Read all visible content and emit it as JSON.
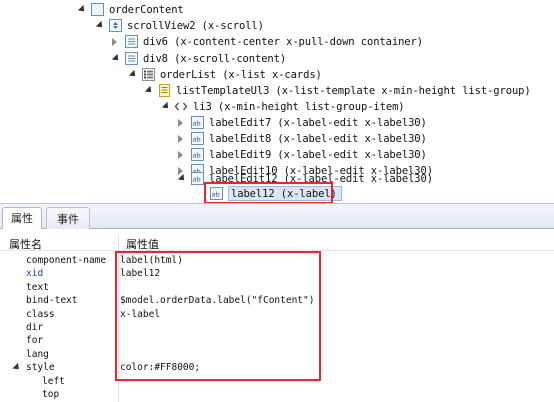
{
  "tree": {
    "nodes": [
      {
        "label": "orderContent"
      },
      {
        "label": "scrollView2 (x-scroll)"
      },
      {
        "label": "div6 (x-content-center x-pull-down container)"
      },
      {
        "label": "div8 (x-scroll-content)"
      },
      {
        "label": "orderList (x-list x-cards)"
      },
      {
        "label": "listTemplateUl3 (x-list-template x-min-height list-group)"
      },
      {
        "label": "li3 (x-min-height list-group-item)"
      },
      {
        "label": "labelEdit7 (x-label-edit x-label30)"
      },
      {
        "label": "labelEdit8 (x-label-edit x-label30)"
      },
      {
        "label": "labelEdit9 (x-label-edit x-label30)"
      },
      {
        "label": "labelEdit10 (x-label-edit x-label30)"
      },
      {
        "label": "labelEdit12 (x-label-edit x-label30)"
      },
      {
        "label": "label12 (x-label)"
      }
    ]
  },
  "tabs": [
    {
      "label": "属性"
    },
    {
      "label": "事件"
    }
  ],
  "properties": {
    "header": {
      "name": "属性名",
      "value": "属性值"
    },
    "rows": [
      {
        "name": "component-name",
        "value": "label(html)"
      },
      {
        "name": "xid",
        "value": "label12"
      },
      {
        "name": "text",
        "value": ""
      },
      {
        "name": "bind-text",
        "value": "$model.orderData.label(\"fContent\")"
      },
      {
        "name": "class",
        "value": "x-label"
      },
      {
        "name": "dir",
        "value": ""
      },
      {
        "name": "for",
        "value": ""
      },
      {
        "name": "lang",
        "value": ""
      },
      {
        "name": "style",
        "value": "color:#FF8000;"
      },
      {
        "name": "left",
        "value": ""
      },
      {
        "name": "top",
        "value": ""
      }
    ]
  },
  "colors": {
    "highlight_border": "#e8262b",
    "selected_background": "#dbe7f6",
    "xid_label": "#1d3fd1"
  }
}
